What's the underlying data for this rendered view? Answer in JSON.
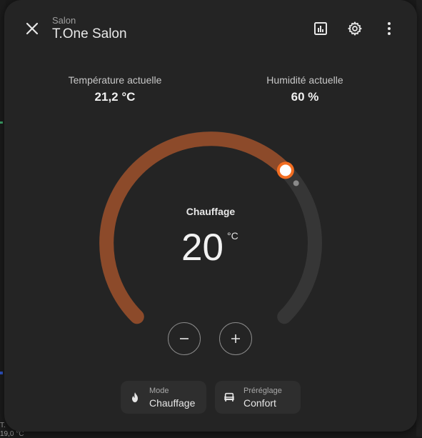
{
  "header": {
    "area": "Salon",
    "title": "T.One Salon"
  },
  "stats": {
    "current_temp_label": "Température actuelle",
    "current_temp_value": "21,2 °C",
    "humidity_label": "Humidité actuelle",
    "humidity_value": "60 %"
  },
  "thermostat": {
    "mode": "Chauffage",
    "target": "20",
    "unit": "°C",
    "target_fraction": 0.67,
    "accent_color": "#8c4a2a",
    "handle_color": "#f26d21",
    "track_color": "#363636"
  },
  "modes": {
    "mode_label": "Mode",
    "mode_value": "Chauffage",
    "preset_label": "Préréglage",
    "preset_value": "Confort"
  },
  "background": {
    "bottom_text_1": "T.",
    "bottom_text_2": "19,0 °C"
  }
}
